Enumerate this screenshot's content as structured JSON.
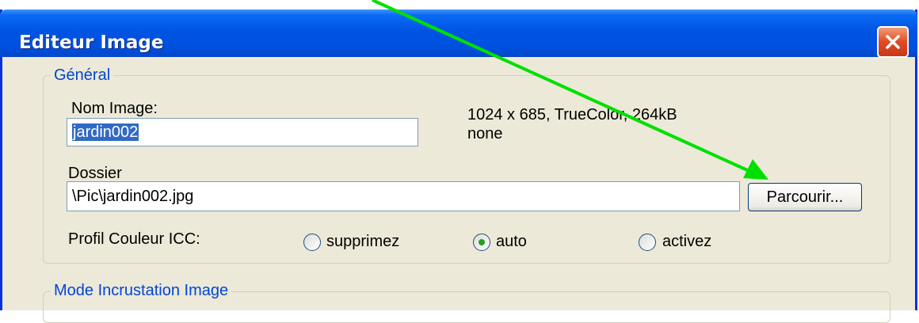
{
  "window": {
    "title": "Editeur Image",
    "close_label": "Close"
  },
  "general": {
    "legend": "Général",
    "name_label": "Nom Image:",
    "name_value": "jardin002",
    "info_line1": "1024 x 685, TrueColor, 264kB",
    "info_line2": "none",
    "folder_label": "Dossier",
    "folder_value": "\\Pic\\jardin002.jpg",
    "browse_label": "Parcourir...",
    "icc_label": "Profil Couleur ICC:",
    "icc_options": [
      {
        "label": "supprimez",
        "selected": false
      },
      {
        "label": "auto",
        "selected": true
      },
      {
        "label": "activez",
        "selected": false
      }
    ]
  },
  "embed": {
    "legend": "Mode Incrustation Image"
  },
  "annotation": {
    "arrow_color": "#00E000"
  }
}
